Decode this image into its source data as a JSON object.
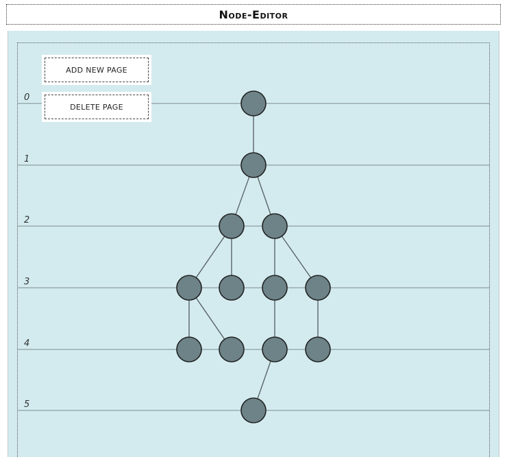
{
  "app": {
    "title": "Node-Editor"
  },
  "buttons": {
    "add_page": "ADD NEW PAGE",
    "delete_page": "DELETE PAGE"
  },
  "levels": [
    "0",
    "1",
    "2",
    "3",
    "4",
    "5"
  ],
  "nodes": [
    {
      "id": "n0",
      "level": 0
    },
    {
      "id": "n1",
      "level": 1
    },
    {
      "id": "n2a",
      "level": 2
    },
    {
      "id": "n2b",
      "level": 2
    },
    {
      "id": "n3a",
      "level": 3
    },
    {
      "id": "n3b",
      "level": 3
    },
    {
      "id": "n3c",
      "level": 3
    },
    {
      "id": "n3d",
      "level": 3
    },
    {
      "id": "n4a",
      "level": 4
    },
    {
      "id": "n4b",
      "level": 4
    },
    {
      "id": "n4c",
      "level": 4
    },
    {
      "id": "n4d",
      "level": 4
    },
    {
      "id": "n5a",
      "level": 5
    }
  ],
  "edges": [
    [
      "n0",
      "n1"
    ],
    [
      "n1",
      "n2a"
    ],
    [
      "n1",
      "n2b"
    ],
    [
      "n2a",
      "n3a"
    ],
    [
      "n2a",
      "n3b"
    ],
    [
      "n2b",
      "n3c"
    ],
    [
      "n2b",
      "n3d"
    ],
    [
      "n3a",
      "n4a"
    ],
    [
      "n3a",
      "n4b"
    ],
    [
      "n3c",
      "n4c"
    ],
    [
      "n3d",
      "n4d"
    ],
    [
      "n4c",
      "n5a"
    ]
  ],
  "colors": {
    "panel_bg": "#d3ebef",
    "node_fill": "#6d8387",
    "node_stroke": "#222222",
    "line": "#7d8a8e"
  }
}
